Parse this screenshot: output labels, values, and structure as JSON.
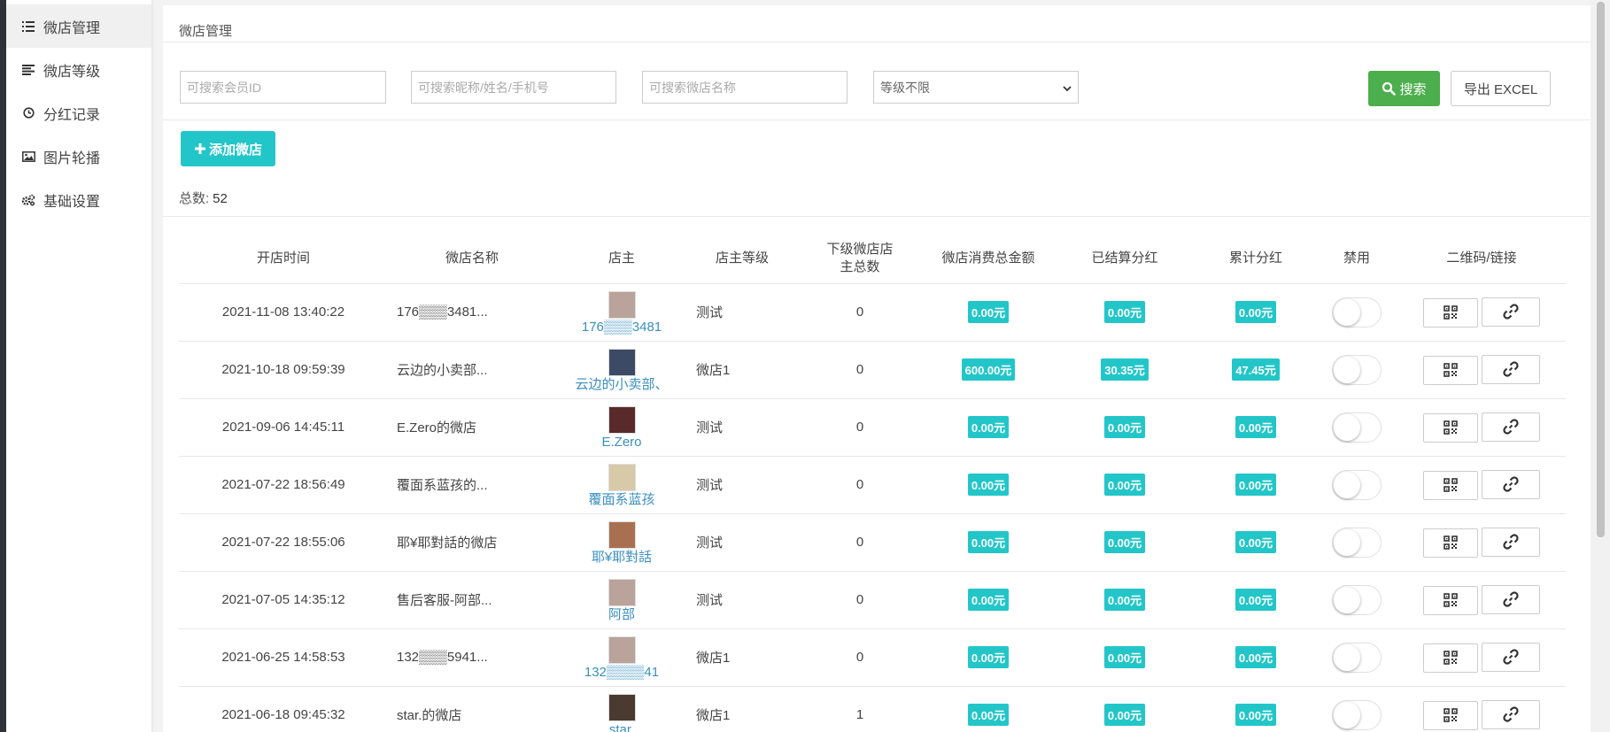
{
  "sidebar": {
    "items": [
      {
        "label": "微店管理",
        "icon": "list-icon",
        "active": true
      },
      {
        "label": "微店等级",
        "icon": "align-left-icon",
        "active": false
      },
      {
        "label": "分红记录",
        "icon": "clock-icon",
        "active": false
      },
      {
        "label": "图片轮播",
        "icon": "image-icon",
        "active": false
      },
      {
        "label": "基础设置",
        "icon": "gears-icon",
        "active": false
      }
    ]
  },
  "page": {
    "title": "微店管理"
  },
  "filters": {
    "member_id_placeholder": "可搜索会员ID",
    "name_placeholder": "可搜索昵称/姓名/手机号",
    "shop_name_placeholder": "可搜索微店名称",
    "level_selected": "等级不限",
    "search_label": "搜索",
    "export_label": "导出 EXCEL"
  },
  "add_button_label": "添加微店",
  "total": {
    "label": "总数:",
    "value": "52"
  },
  "table": {
    "headers": [
      "开店时间",
      "微店名称",
      "店主",
      "店主等级",
      "下级微店店主总数",
      "微店消费总金额",
      "已结算分红",
      "累计分红",
      "禁用",
      "二维码/链接"
    ],
    "header_line1": "下级微店店",
    "header_line2": "主总数",
    "rows": [
      {
        "time": "2021-11-08 13:40:22",
        "name": "176▒▒▒3481...",
        "owner": "176▒▒▒3481",
        "level": "测试",
        "count": "0",
        "consume": "0.00元",
        "settled": "0.00元",
        "total": "0.00元",
        "avatar_color": "#b9a39a"
      },
      {
        "time": "2021-10-18 09:59:39",
        "name": "云边的小卖部...",
        "owner": "云边的小卖部、",
        "level": "微店1",
        "count": "0",
        "consume": "600.00元",
        "settled": "30.35元",
        "total": "47.45元",
        "avatar_color": "#3d4a66"
      },
      {
        "time": "2021-09-06 14:45:11",
        "name": "E.Zero的微店",
        "owner": "E.Zero",
        "level": "测试",
        "count": "0",
        "consume": "0.00元",
        "settled": "0.00元",
        "total": "0.00元",
        "avatar_color": "#5a2a2a"
      },
      {
        "time": "2021-07-22 18:56:49",
        "name": "覆面系蓝孩的...",
        "owner": "覆面系蓝孩",
        "level": "测试",
        "count": "0",
        "consume": "0.00元",
        "settled": "0.00元",
        "total": "0.00元",
        "avatar_color": "#d8c9a8"
      },
      {
        "time": "2021-07-22 18:55:06",
        "name": "耶¥耶對話的微店",
        "owner": "耶¥耶對話",
        "level": "测试",
        "count": "0",
        "consume": "0.00元",
        "settled": "0.00元",
        "total": "0.00元",
        "avatar_color": "#a87050"
      },
      {
        "time": "2021-07-05 14:35:12",
        "name": "售后客服-阿部...",
        "owner": "阿部",
        "level": "测试",
        "count": "0",
        "consume": "0.00元",
        "settled": "0.00元",
        "total": "0.00元",
        "avatar_color": "#b9a39a"
      },
      {
        "time": "2021-06-25 14:58:53",
        "name": "132▒▒▒5941...",
        "owner": "132▒▒▒▒41",
        "level": "微店1",
        "count": "0",
        "consume": "0.00元",
        "settled": "0.00元",
        "total": "0.00元",
        "avatar_color": "#b9a39a"
      },
      {
        "time": "2021-06-18 09:45:32",
        "name": "star.的微店",
        "owner": "star.",
        "level": "微店1",
        "count": "1",
        "consume": "0.00元",
        "settled": "0.00元",
        "total": "0.00元",
        "avatar_color": "#4a3a30"
      }
    ]
  },
  "colors": {
    "accent": "#23c6c8",
    "search": "#4cae4c",
    "link": "#3a8fc0"
  }
}
